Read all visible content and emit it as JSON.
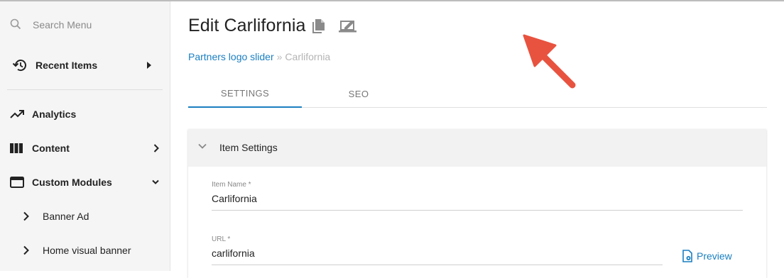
{
  "sidebar": {
    "search": {
      "placeholder": "Search Menu"
    },
    "recent": {
      "label": "Recent Items"
    },
    "items": [
      {
        "label": "Analytics"
      },
      {
        "label": "Content"
      },
      {
        "label": "Custom Modules"
      }
    ],
    "sub_items": [
      {
        "label": "Banner Ad"
      },
      {
        "label": "Home visual banner"
      }
    ]
  },
  "header": {
    "title": "Edit Carlifornia"
  },
  "breadcrumb": {
    "parent": "Partners logo slider",
    "separator": "»",
    "current": "Carlifornia"
  },
  "tabs": [
    {
      "label": "SETTINGS",
      "active": true
    },
    {
      "label": "SEO",
      "active": false
    }
  ],
  "panel": {
    "title": "Item Settings",
    "fields": [
      {
        "label": "Item Name *",
        "value": "Carlifornia"
      },
      {
        "label": "URL *",
        "value": "carlifornia"
      }
    ],
    "preview_label": "Preview"
  },
  "colors": {
    "accent": "#1a7fc1",
    "sidebar_bg": "#f5f5f5",
    "annotation_arrow": "#e8533f"
  },
  "icons": {
    "copy": "copy-icon",
    "edit": "edit-window-icon"
  }
}
